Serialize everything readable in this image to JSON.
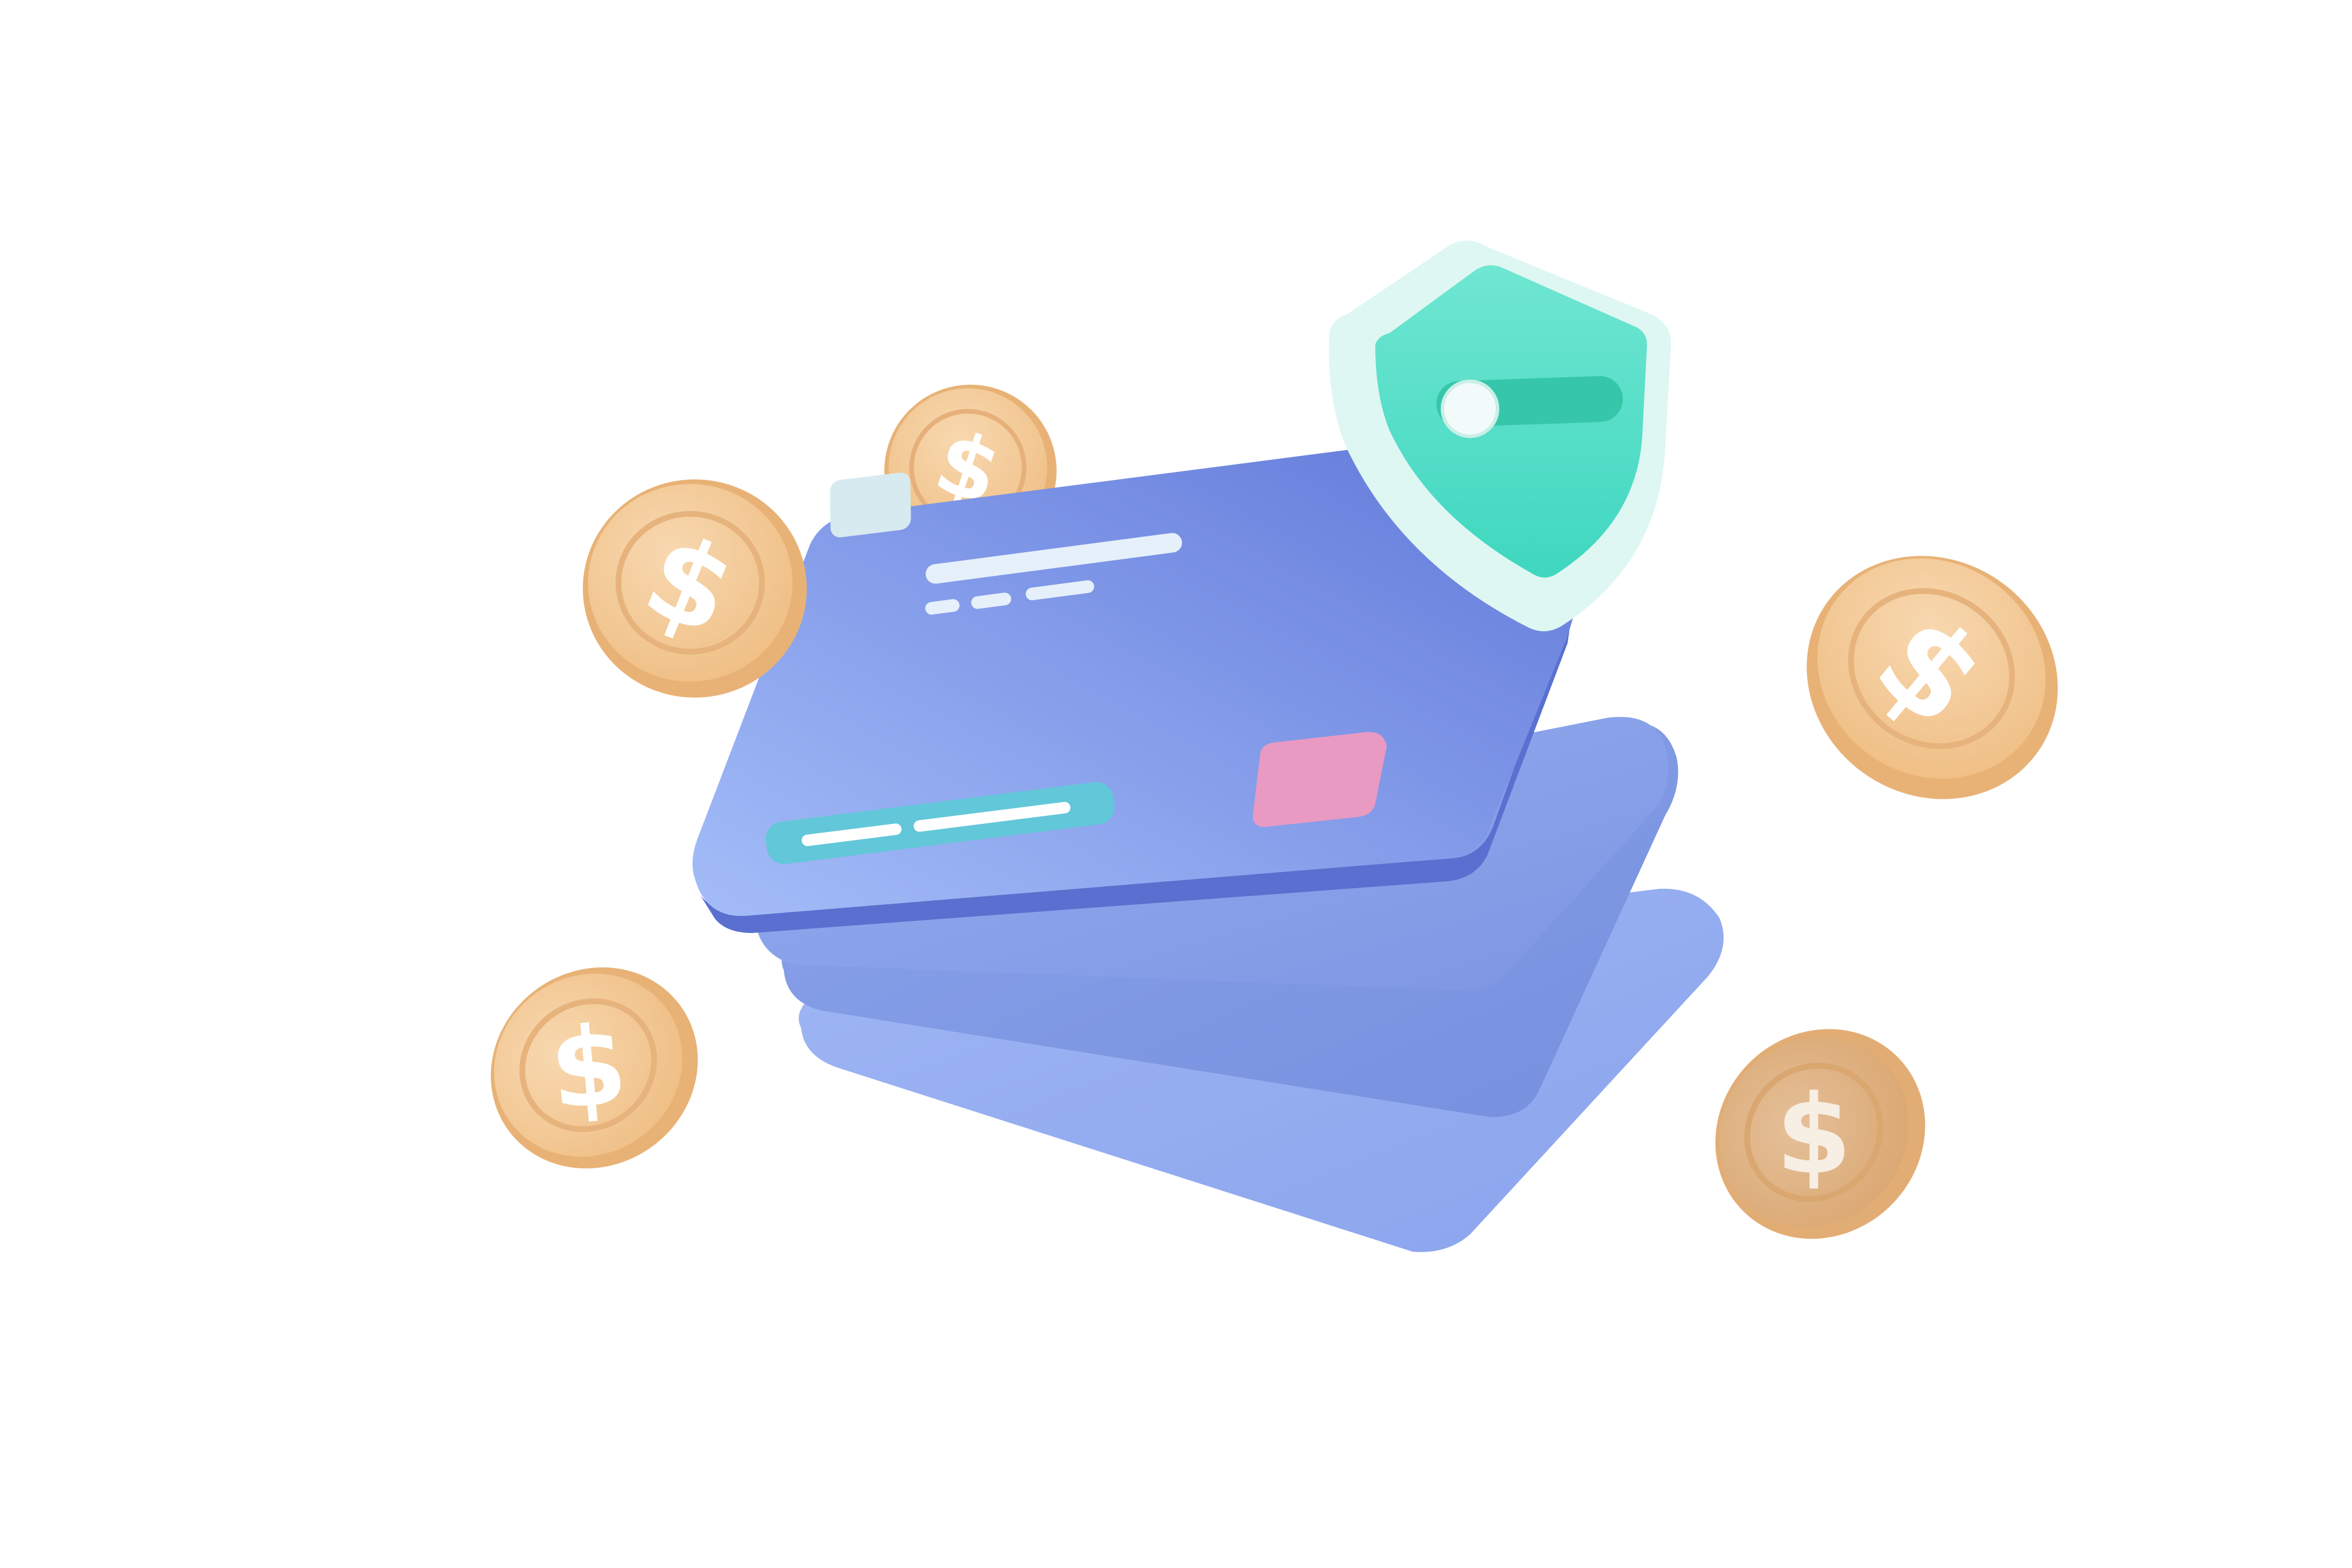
{
  "illustration": {
    "subject": "secure-credit-card-payment",
    "coin_symbol": "$",
    "shield_toggle_state": "on",
    "colors": {
      "background": "#ffffff",
      "card_front_light": "#a4bdf8",
      "card_front_dark": "#6077d9",
      "card_stack": "#8ea6ea",
      "shield_outer": "#dff7f2",
      "shield_inner": "#56e0c8",
      "toggle_track": "#3ccfb0",
      "chip": "#e89ac2",
      "magstripe": "#62c7d8",
      "coin_face": "#f3c893",
      "coin_rim": "#e9b577",
      "coin_symbol": "#ffffff"
    }
  }
}
